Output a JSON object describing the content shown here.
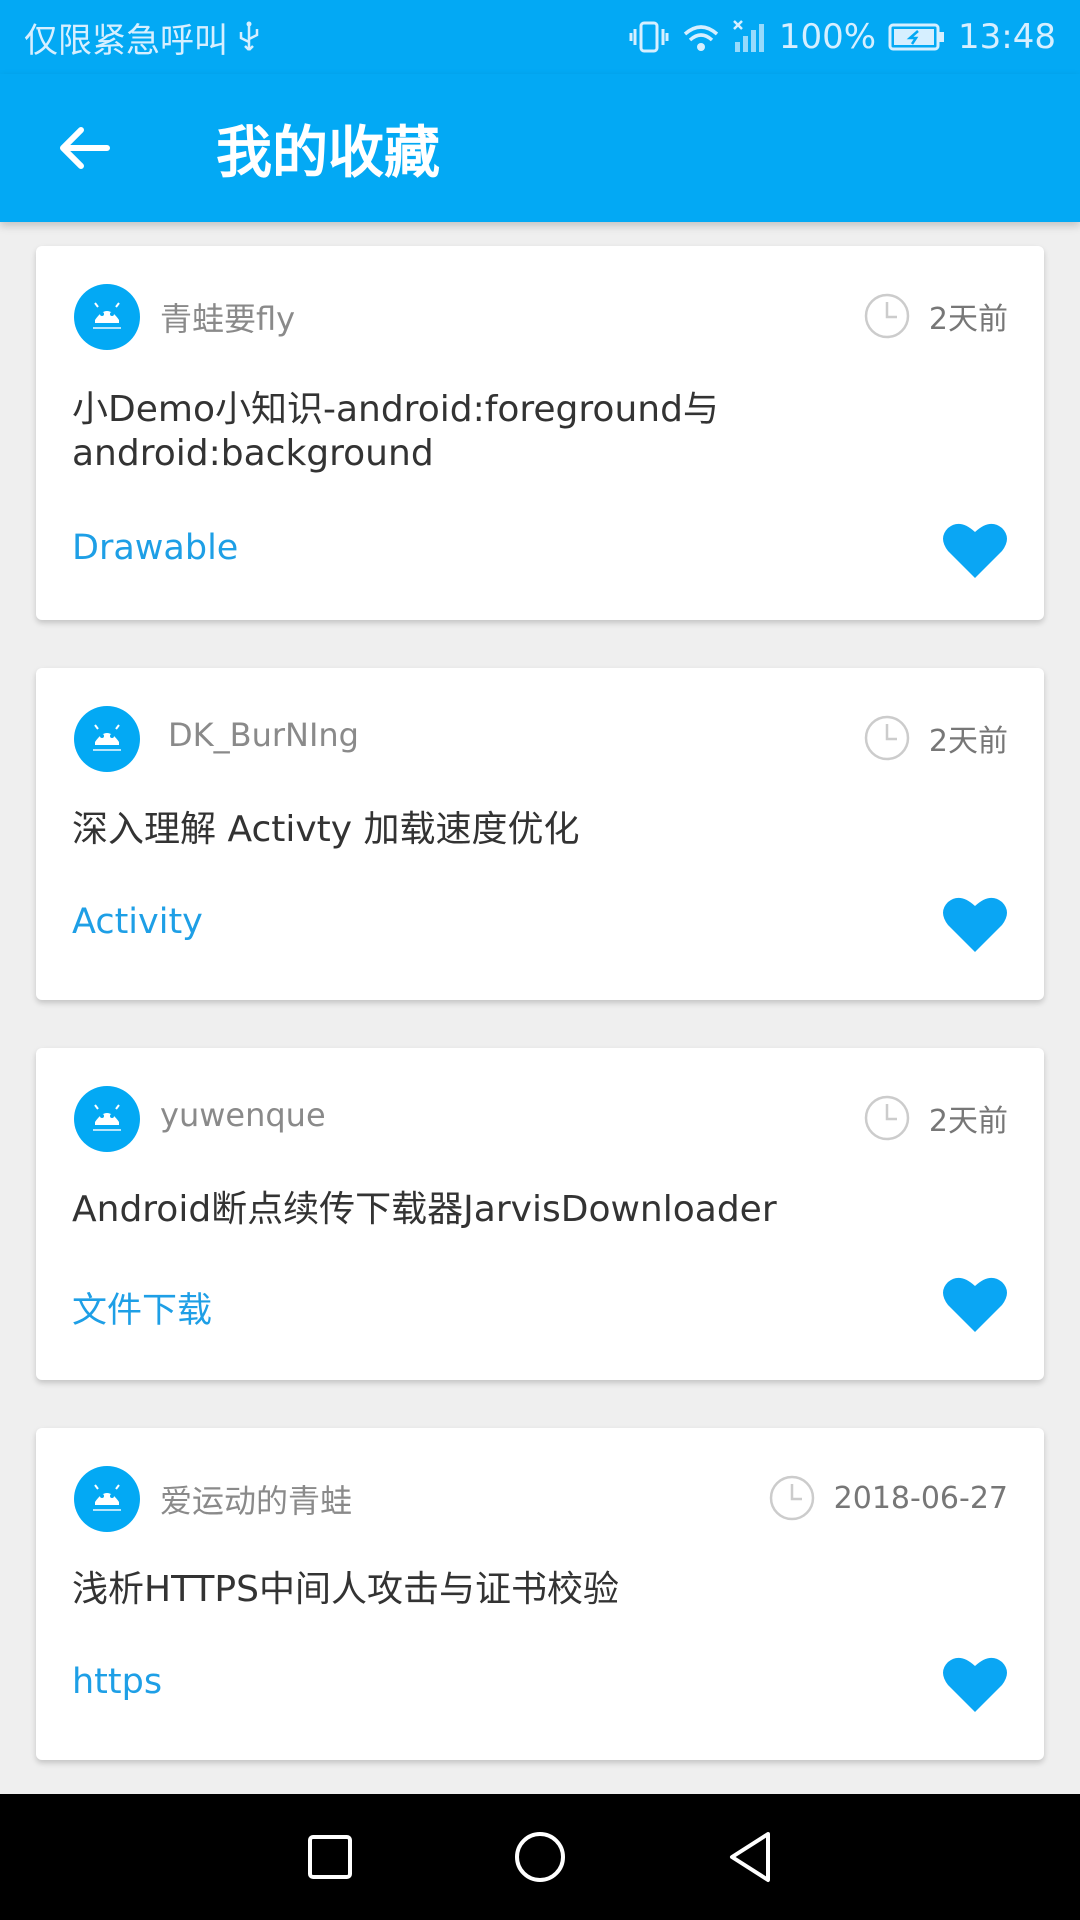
{
  "status_bar": {
    "carrier": "仅限紧急呼叫",
    "battery": "100%",
    "time": "13:48",
    "icons": [
      "usb-icon",
      "vibrate-icon",
      "wifi-icon",
      "signal-icon",
      "battery-icon"
    ]
  },
  "app_bar": {
    "title": "我的收藏",
    "back_icon": "arrow-left-icon",
    "color": "#03a9f4"
  },
  "articles": [
    {
      "author": "青蛙要fly",
      "time": "2天前",
      "title": "小Demo小知识-android:foreground与android:background",
      "tag": "Drawable"
    },
    {
      "author": "DK_BurNIng",
      "time": "2天前",
      "title": "深入理解 Activty 加载速度优化",
      "tag": "Activity"
    },
    {
      "author": "yuwenque",
      "time": "2天前",
      "title": "Android断点续传下载器JarvisDownloader",
      "tag": "文件下载"
    },
    {
      "author": "爱运动的青蛙",
      "time": "2018-06-27",
      "title": "浅析HTTPS中间人攻击与证书校验",
      "tag": "https"
    }
  ],
  "nav_bar": {
    "icons": [
      "recent-apps-icon",
      "home-icon",
      "back-icon"
    ]
  },
  "colors": {
    "accent": "#03a9f4",
    "tag": "#1e9fe6",
    "heart": "#0aa6f4"
  }
}
